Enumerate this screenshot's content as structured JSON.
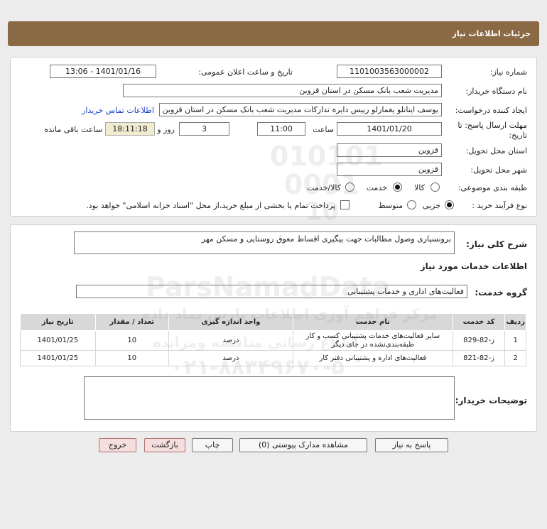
{
  "header": {
    "title": "جزئیات اطلاعات نیاز"
  },
  "form": {
    "need_number_label": "شماره نیاز:",
    "need_number": "1101003563000002",
    "announce_label": "تاریخ و ساعت اعلان عمومی:",
    "announce_value": "1401/01/16 - 13:06",
    "buyer_org_label": "نام دستگاه خریدار:",
    "buyer_org": "مدیریت شعب بانک مسکن در استان قزوین",
    "requester_label": "ایجاد کننده درخواست:",
    "requester": "یوسف اینانلو یغمارلو رییس دایره تدارکات مدیریت شعب بانک مسکن در استان قزوین",
    "contact_link": "اطلاعات تماس خریدار",
    "deadline_label": "مهلت ارسال پاسخ: تا",
    "deadline_label2": "تاریخ:",
    "deadline_date": "1401/01/20",
    "time_label": "ساعت",
    "deadline_time": "11:00",
    "days": "3",
    "days_label": "روز و",
    "remaining_time": "18:11:18",
    "remaining_label": "ساعت باقی مانده",
    "province_label": "استان محل تحویل:",
    "province": "قزوین",
    "city_label": "شهر محل تحویل:",
    "city": "قزوین",
    "category_label": "طبقه بندی موضوعی:",
    "category_options": [
      "کالا",
      "خدمت",
      "کالا/خدمت"
    ],
    "category_selected": "خدمت",
    "process_label": "نوع فرآیند خرید :",
    "process_options": [
      "جزیی",
      "متوسط"
    ],
    "process_selected": "جزیی",
    "payment_note": "پرداخت تمام یا بخشی از مبلغ خرید،از محل \"اسناد خزانه اسلامی\" خواهد بود."
  },
  "details": {
    "summary_label": "شرح کلی نیاز:",
    "summary": "برونسپاری وصول مطالبات جهت پیگیری اقساط معوق روستایی و مسکن مهر",
    "services_heading": "اطلاعات خدمات مورد نیاز",
    "service_group_label": "گروه خدمت:",
    "service_group": "فعالیت‌های اداری و خدمات پشتیبانی",
    "table": {
      "headers": [
        "ردیف",
        "کد خدمت",
        "نام خدمت",
        "واحد اندازه گیری",
        "تعداد / مقدار",
        "تاریخ نیاز"
      ],
      "rows": [
        [
          "1",
          "ز-82-829",
          "سایر فعالیت‌های خدمات پشتیبانی کسب و کار طبقه‌بندی‌نشده در جای دیگر",
          "درصد",
          "10",
          "1401/01/25"
        ],
        [
          "2",
          "ز-82-821",
          "فعالیت‌های اداره و پشتیبانی دفتر کار",
          "درصد",
          "10",
          "1401/01/25"
        ]
      ]
    },
    "buyer_notes_label": "توضیحات خریدار:",
    "buyer_notes": ""
  },
  "buttons": {
    "reply": "پاسخ به نیاز",
    "view_docs": "مشاهده مدارک پیوستی (0)",
    "print": "چاپ",
    "back": "بازگشت",
    "exit": "خروج"
  },
  "watermark": {
    "brand": "ParsNamadData",
    "line1": "مرکز فراهم آوری اطلاعات پارس نماد داده",
    "line2": "اطلاع رسانی مناقصه ومزایده",
    "phone": "۰۲۱-۸۸۳۴۹۶۷۰-۵"
  },
  "colors": {
    "header_bg": "#8a6a45",
    "link": "#1a43c9",
    "remaining_bg": "#f1ecd0"
  }
}
